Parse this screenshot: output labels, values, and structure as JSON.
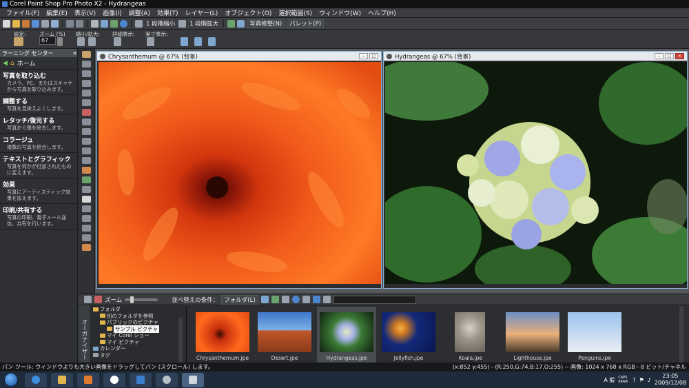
{
  "app": {
    "title": "Corel Paint Shop Pro Photo X2 - Hydrangeas"
  },
  "menu": [
    "ファイル(F)",
    "編集(E)",
    "表示(V)",
    "画像(I)",
    "調整(A)",
    "効果(T)",
    "レイヤー(L)",
    "オブジェクト(O)",
    "選択範囲(S)",
    "ウィンドウ(W)",
    "ヘルプ(H)"
  ],
  "toolbar": {
    "step_down": "1 段階縮小",
    "step_up": "1 段階拡大",
    "photo_fix": "写真修整(N)",
    "palette": "パレット(P)"
  },
  "options": {
    "preset": "設定:",
    "zoom_label": "ズーム (%)",
    "zoom_value": "67",
    "zoom_inout": "縮小/拡大:",
    "detail": "詳細表示:",
    "actual": "実寸表示:"
  },
  "learning": {
    "header": "ラーニング センター",
    "home": "ホーム",
    "sections": [
      {
        "title": "写真を取り込む",
        "desc": "カメラ、PC、またはスキャナから写真を取り込みます。"
      },
      {
        "title": "調整する",
        "desc": "写真を見栄えよくします。"
      },
      {
        "title": "レタッチ/復元する",
        "desc": "写真から傷を除去します。"
      },
      {
        "title": "コラージュ",
        "desc": "複数の写真を結合します。"
      },
      {
        "title": "テキストとグラフィック",
        "desc": "写真を何かが付加されたものに変えます。"
      },
      {
        "title": "効果",
        "desc": "写真にアーティスティック効果を加えます。"
      },
      {
        "title": "印刷/共有する",
        "desc": "写真の印刷、電子メール送信、共有を行います。"
      }
    ]
  },
  "windows": [
    {
      "title": "Chrysanthemum @ 67% (背景)"
    },
    {
      "title": "Hydrangeas @ 67% (背景)"
    }
  ],
  "organizer": {
    "tab": "オーガナイザー",
    "zoom": "ズーム",
    "sort_label": "並べ替えの条件：",
    "sort_value": "フォルダ(L)",
    "folders": [
      "フォルダ",
      "別のフォルダを参照",
      "パブリックのピクチャ",
      "サンプル ピクチャ",
      "マイ Corel ショー",
      "マイ ピクチャ",
      "カレンダー",
      "タグ"
    ],
    "thumbs": [
      "Chrysanthemum.jpe",
      "Desert.jpe",
      "Hydrangeas.jpe",
      "Jellyfish.jpe",
      "Koala.jpe",
      "Lighthouse.jpe",
      "Penguins.jpe"
    ]
  },
  "status": {
    "left": "パン ツール: ウィンドウよりも大きい画像をドラッグしてパン (スクロール) します。",
    "right": "(x:852 y:455) - (R:250,G:74,B:17,O:255) -- 画像: 1024 x 768 x RGB - 8 ビット/チャネル"
  },
  "taskbar": {
    "ime": "A 般",
    "caps": "CAPS KANA",
    "time": "23:05",
    "date": "2009/12/08"
  }
}
